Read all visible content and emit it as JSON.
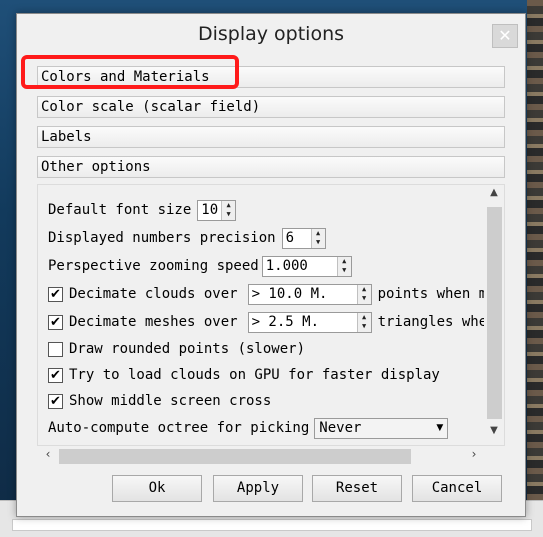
{
  "dialog": {
    "title": "Display options",
    "close_icon": "close-icon",
    "close_glyph": "✕"
  },
  "sections": [
    {
      "label": "Colors and Materials",
      "highlighted": true
    },
    {
      "label": "Color scale (scalar field)"
    },
    {
      "label": "Labels"
    },
    {
      "label": "Other options"
    }
  ],
  "options": {
    "font_size_label": "Default font size",
    "font_size_value": "10",
    "precision_label": "Displayed numbers precision",
    "precision_value": "6",
    "zoom_speed_label": "Perspective zooming speed",
    "zoom_speed_value": "1.000",
    "decimate_clouds": {
      "checked": true,
      "label": "Decimate clouds over",
      "value": "> 10.0 M.",
      "suffix": "points when mo"
    },
    "decimate_meshes": {
      "checked": true,
      "label": "Decimate meshes over",
      "value": "> 2.5 M.",
      "suffix": "triangles when"
    },
    "rounded_points": {
      "checked": false,
      "label": "Draw rounded points (slower)"
    },
    "gpu_load": {
      "checked": true,
      "label": "Try to load clouds on GPU for faster display"
    },
    "middle_cross": {
      "checked": true,
      "label": "Show middle screen cross"
    },
    "octree_label": "Auto-compute octree for picking",
    "octree_value": "Never"
  },
  "check_glyph": "✔",
  "buttons": {
    "ok": "Ok",
    "apply": "Apply",
    "reset": "Reset",
    "cancel": "Cancel"
  },
  "colors": {
    "highlight": "#ff1a1a",
    "dialog_bg": "#f0f0f0"
  }
}
